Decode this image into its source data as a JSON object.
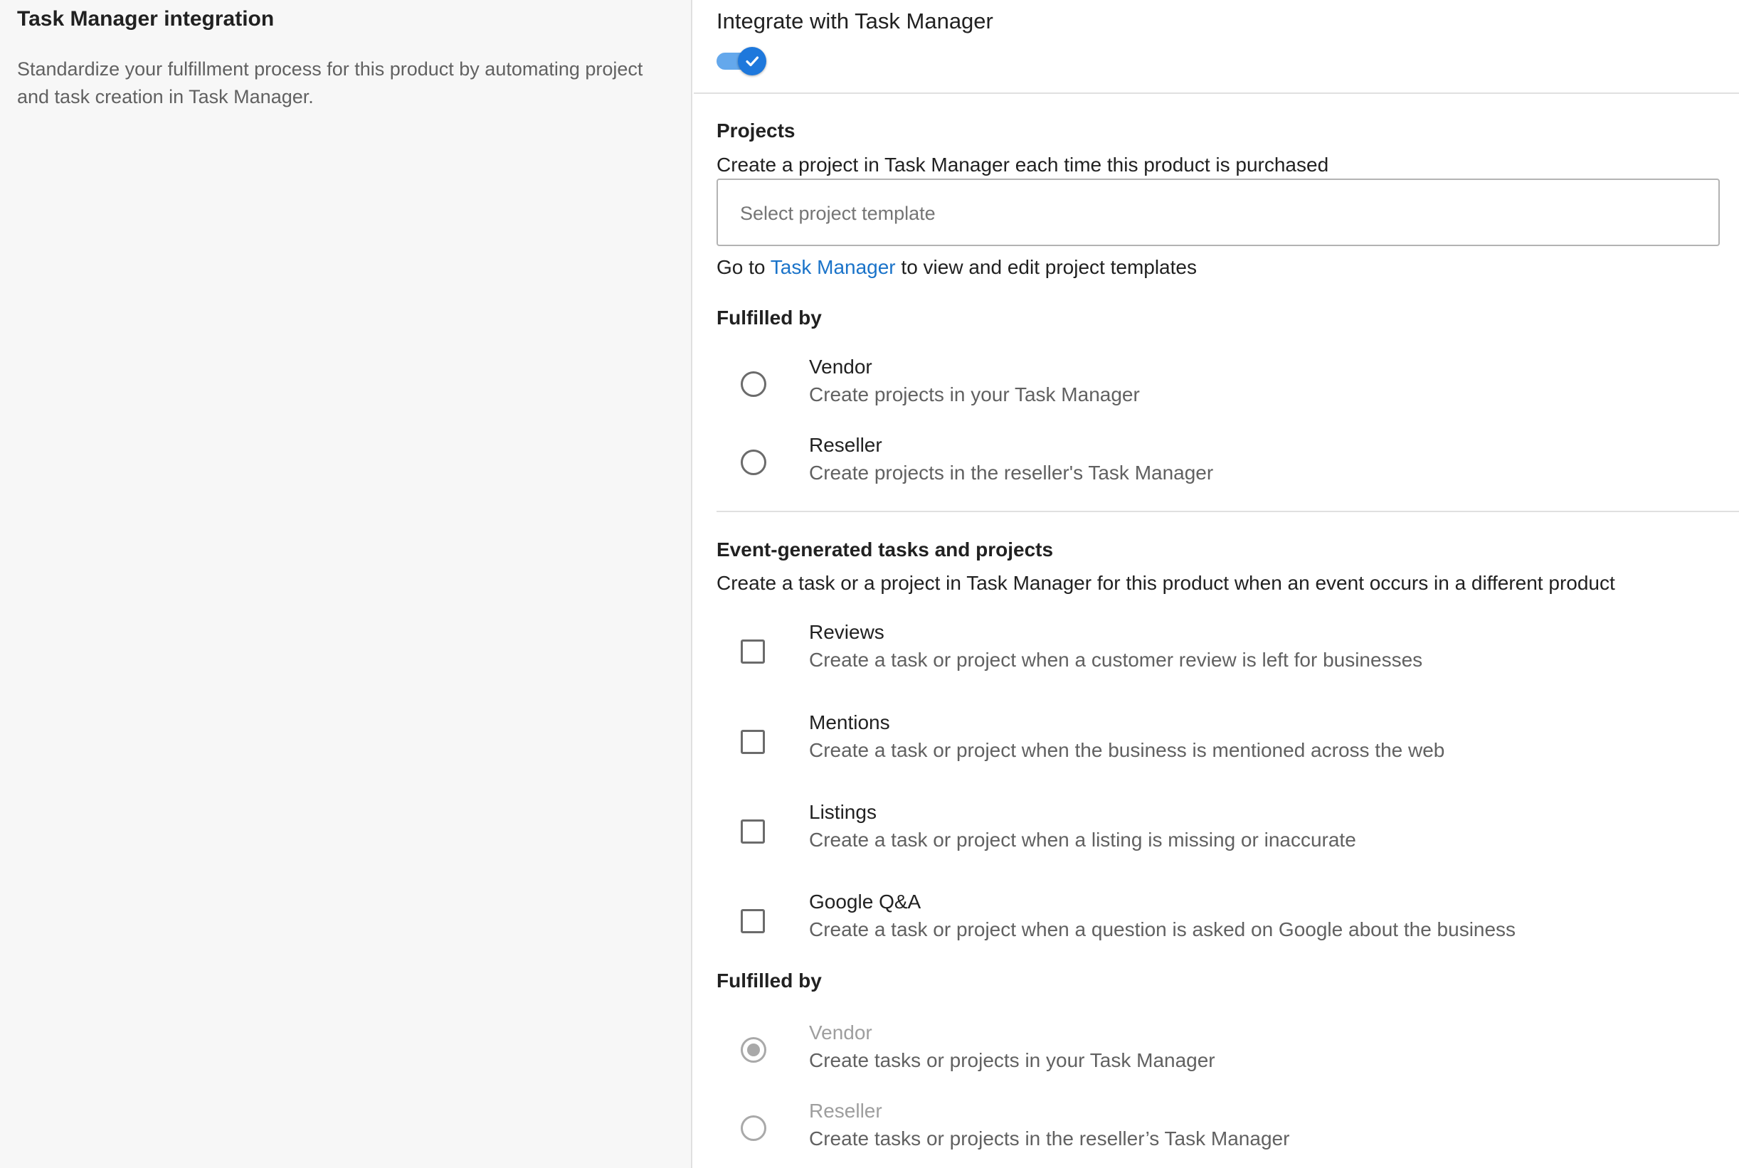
{
  "left": {
    "title": "Task Manager integration",
    "description": "Standardize your fulfillment process for this product by automating project and task creation in Task Manager."
  },
  "integration": {
    "toggle_label": "Integrate with Task Manager",
    "enabled": true,
    "accent_color": "#1e78dc"
  },
  "projects": {
    "heading": "Projects",
    "description": "Create a project in Task Manager each time this product is purchased",
    "select_placeholder": "Select project template",
    "help_prefix": "Go to",
    "help_link": "Task Manager",
    "help_suffix": "to view and edit project templates",
    "fulfilled_by": {
      "heading": "Fulfilled by",
      "options": [
        {
          "label": "Vendor",
          "description": "Create projects in your Task Manager",
          "selected": false
        },
        {
          "label": "Reseller",
          "description": "Create projects in the reseller's Task Manager",
          "selected": false
        }
      ]
    }
  },
  "events": {
    "heading": "Event-generated tasks and projects",
    "description": "Create a task or a project in Task Manager for this product when an event occurs in a different product",
    "options": [
      {
        "label": "Reviews",
        "description": "Create a task or project when a customer review is left for businesses",
        "checked": false
      },
      {
        "label": "Mentions",
        "description": "Create a task or project when the business is mentioned across the web",
        "checked": false
      },
      {
        "label": "Listings",
        "description": "Create a task or project when a listing is missing or inaccurate",
        "checked": false
      },
      {
        "label": "Google Q&A",
        "description": "Create a task or project when a question is asked on Google about the business",
        "checked": false
      }
    ],
    "fulfilled_by": {
      "heading": "Fulfilled by",
      "options": [
        {
          "label": "Vendor",
          "description": "Create tasks or projects in your Task Manager",
          "selected": true,
          "disabled": true
        },
        {
          "label": "Reseller",
          "description": "Create tasks or projects in the reseller’s Task Manager",
          "selected": false,
          "disabled": true
        }
      ]
    }
  }
}
